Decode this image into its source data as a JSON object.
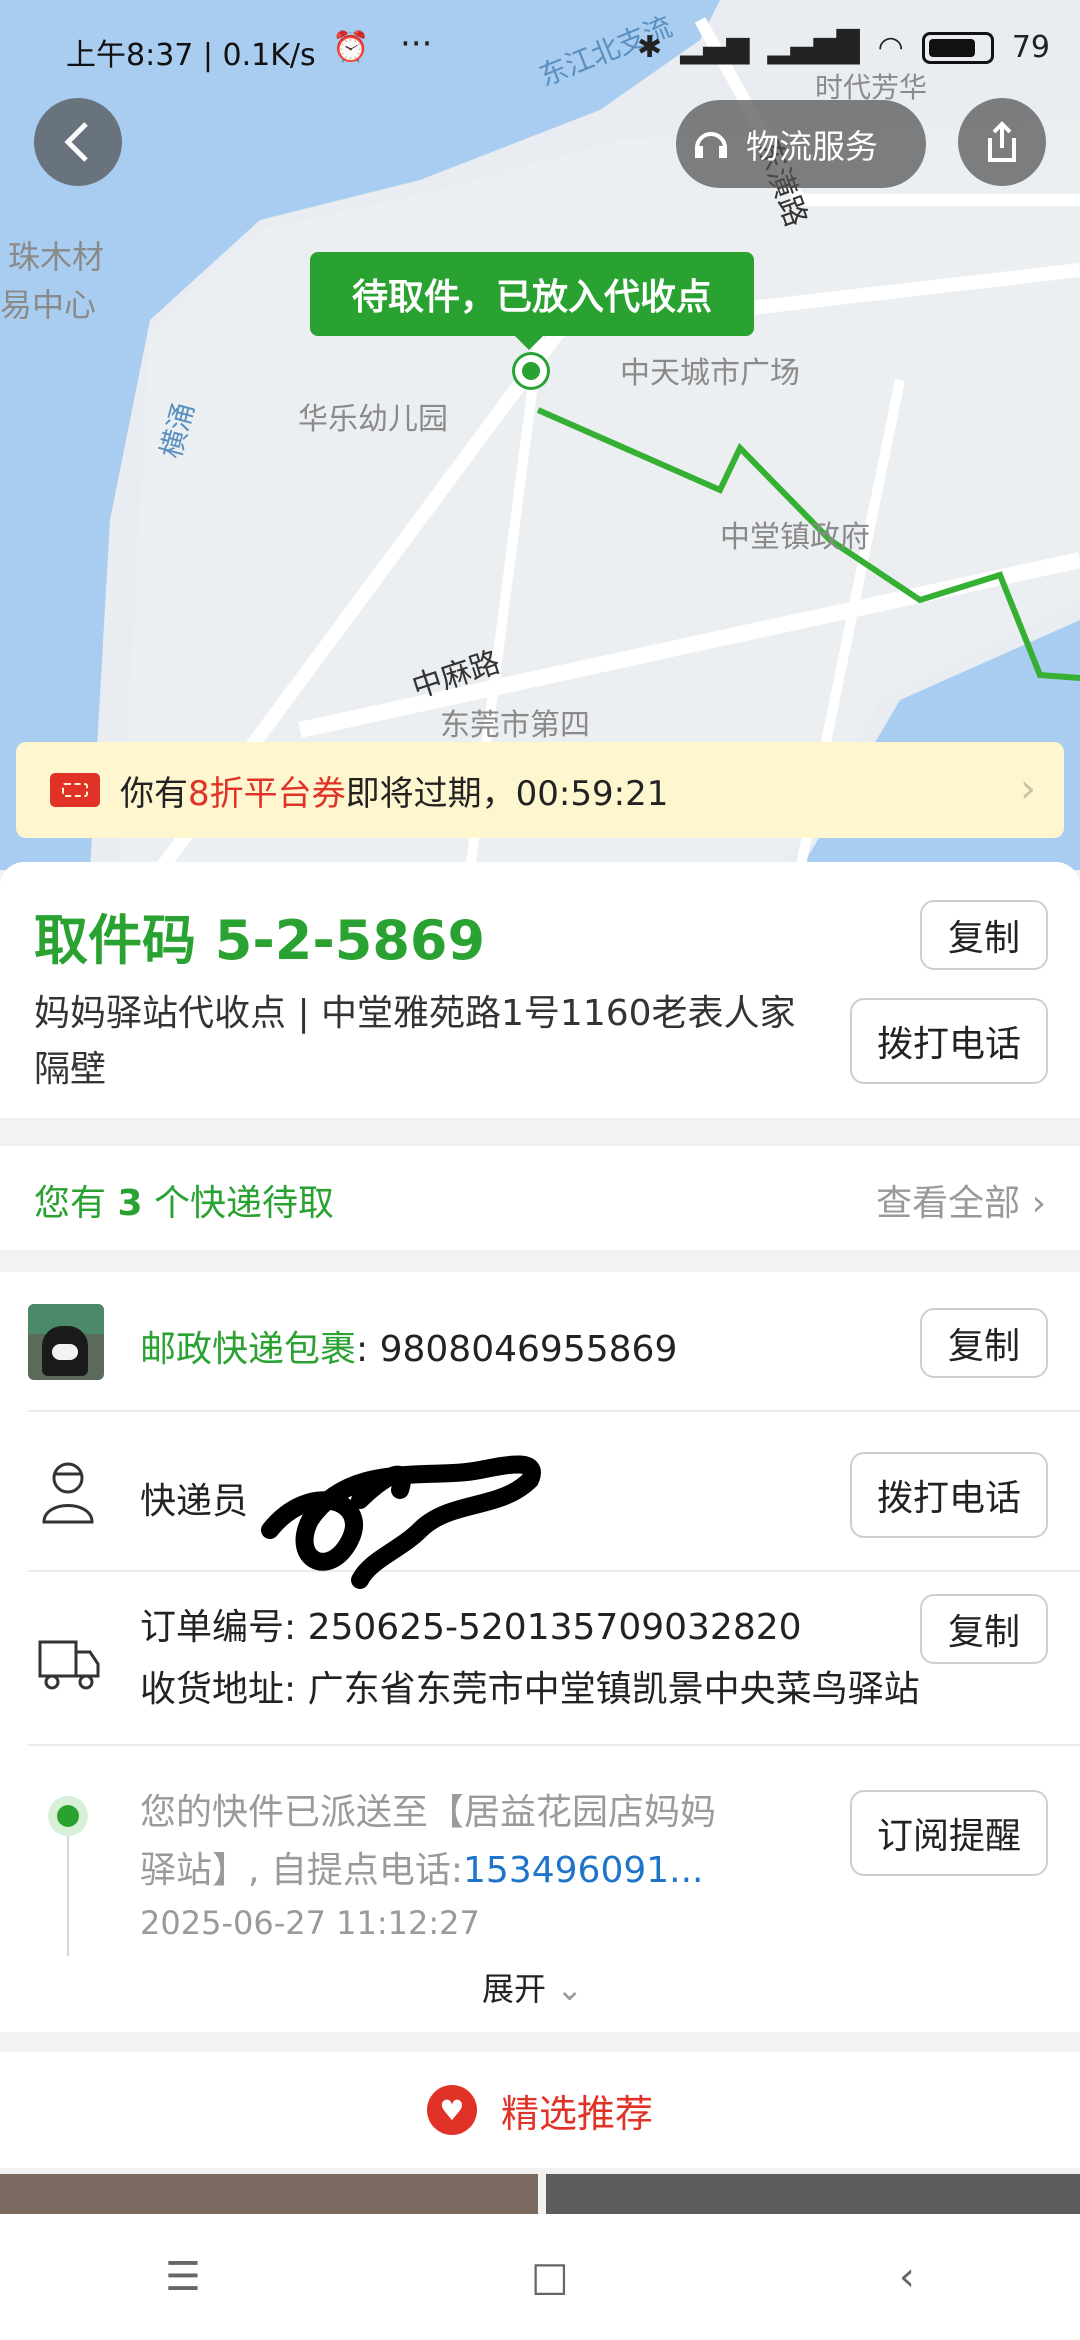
{
  "status_bar": {
    "time": "上午8:37 | 0.1K/s",
    "battery": "79"
  },
  "map": {
    "labels": {
      "l1": "东江北支流",
      "l2": "时代芳华",
      "l3": "珠木材",
      "l4": "易中心",
      "l5": "中天城市广场",
      "l6": "华乐幼儿园",
      "l7": "横涌",
      "l8": "中堂镇政府",
      "l9": "中麻路",
      "l10": "东莞市第四",
      "l11": "东潢路"
    },
    "bubble": "待取件，已放入代收点"
  },
  "header": {
    "logistics_service": "物流服务"
  },
  "coupon": {
    "prefix": "你有",
    "highlight": "8折平台券",
    "suffix": "即将过期，00:59:21"
  },
  "pickup": {
    "code_label": "取件码 5-2-5869",
    "copy": "复制",
    "address": "妈妈驿站代收点 | 中堂雅苑路1号1160老表人家隔壁",
    "call": "拨打电话"
  },
  "pending": {
    "prefix": "您有 ",
    "count": "3",
    "suffix": " 个快递待取",
    "view_all": "查看全部"
  },
  "package": {
    "carrier": "邮政快递包裹",
    "tracking": ": 9808046955869",
    "copy": "复制",
    "courier_label": "快递员",
    "call": "拨打电话",
    "order_no": "订单编号: 250625-520135709032820",
    "order_copy": "复制",
    "ship_address": "收货地址: 广东省东莞市中堂镇凯景中央菜鸟驿站",
    "timeline_text1": "您的快件已派送至【居益花园店妈妈",
    "timeline_text2": "驿站】, 自提点电话:",
    "timeline_phone": "153496091...",
    "timeline_time": "2025-06-27 11:12:27",
    "subscribe": "订阅提醒",
    "expand": "展开"
  },
  "recommend": {
    "title": "精选推荐"
  }
}
